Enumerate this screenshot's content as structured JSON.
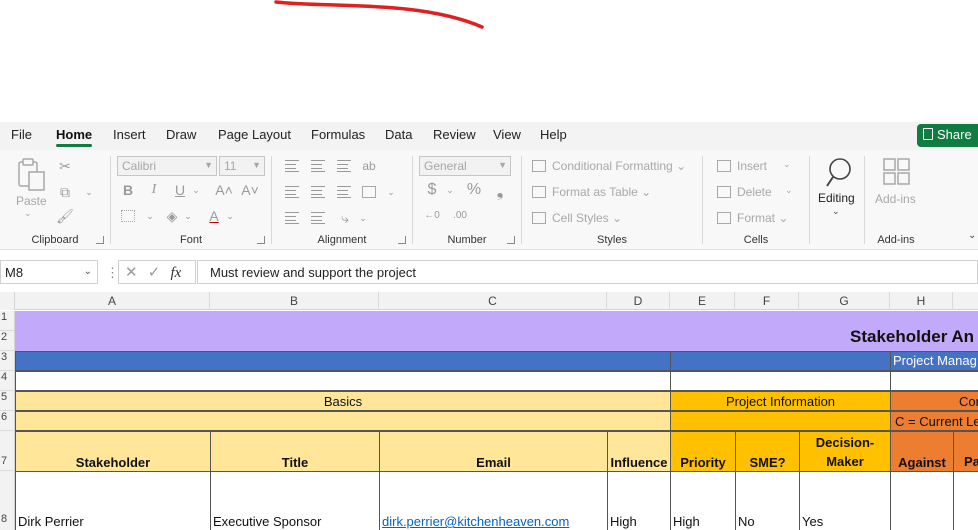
{
  "menu": {
    "tabs": [
      "File",
      "Home",
      "Insert",
      "Draw",
      "Page Layout",
      "Formulas",
      "Data",
      "Review",
      "View",
      "Help"
    ],
    "active": "Home",
    "share_label": "Share"
  },
  "ribbon": {
    "clipboard": {
      "paste": "Paste",
      "label": "Clipboard"
    },
    "font": {
      "name": "Calibri",
      "size": "11",
      "label": "Font"
    },
    "alignment": {
      "label": "Alignment"
    },
    "number": {
      "format": "General",
      "label": "Number"
    },
    "styles": {
      "conditional": "Conditional Formatting",
      "format_table": "Format as Table",
      "cell_styles": "Cell Styles",
      "label": "Styles"
    },
    "cells": {
      "insert": "Insert",
      "delete": "Delete",
      "format": "Format",
      "label": "Cells"
    },
    "editing": {
      "label": "Editing"
    },
    "addins": {
      "button": "Add-ins",
      "label": "Add-ins"
    }
  },
  "formula_bar": {
    "name_box": "M8",
    "fx": "fx",
    "value": "Must review and support the project"
  },
  "grid": {
    "columns": [
      "A",
      "B",
      "C",
      "D",
      "E",
      "F",
      "G",
      "H"
    ],
    "rows": [
      "1",
      "2",
      "3",
      "4",
      "5",
      "6",
      "7",
      "8"
    ],
    "title": "Stakeholder An",
    "row3_right": "Project Manag",
    "basics": "Basics",
    "project_info": "Project Information",
    "con": "Con",
    "current_level": "C = Current Le",
    "headers": {
      "stakeholder": "Stakeholder",
      "title": "Title",
      "email": "Email",
      "influence": "Influence",
      "priority": "Priority",
      "sme": "SME?",
      "decision_1": "Decision-",
      "decision_2": "Maker",
      "against": "Against",
      "pa": "Pa"
    },
    "row8": {
      "stakeholder": "Dirk Perrier",
      "title": "Executive Sponsor",
      "email": "dirk.perrier@kitchenheaven.com",
      "influence": "High",
      "priority": "High",
      "sme": "No",
      "decision_maker": "Yes"
    }
  },
  "colors": {
    "purple": "#c3a9f9",
    "blue": "#4472c4",
    "light_yellow": "#ffe699",
    "gold": "#ffc000",
    "orange": "#ed7d31",
    "excel_green": "#107c41",
    "pen_red": "#e02020"
  }
}
